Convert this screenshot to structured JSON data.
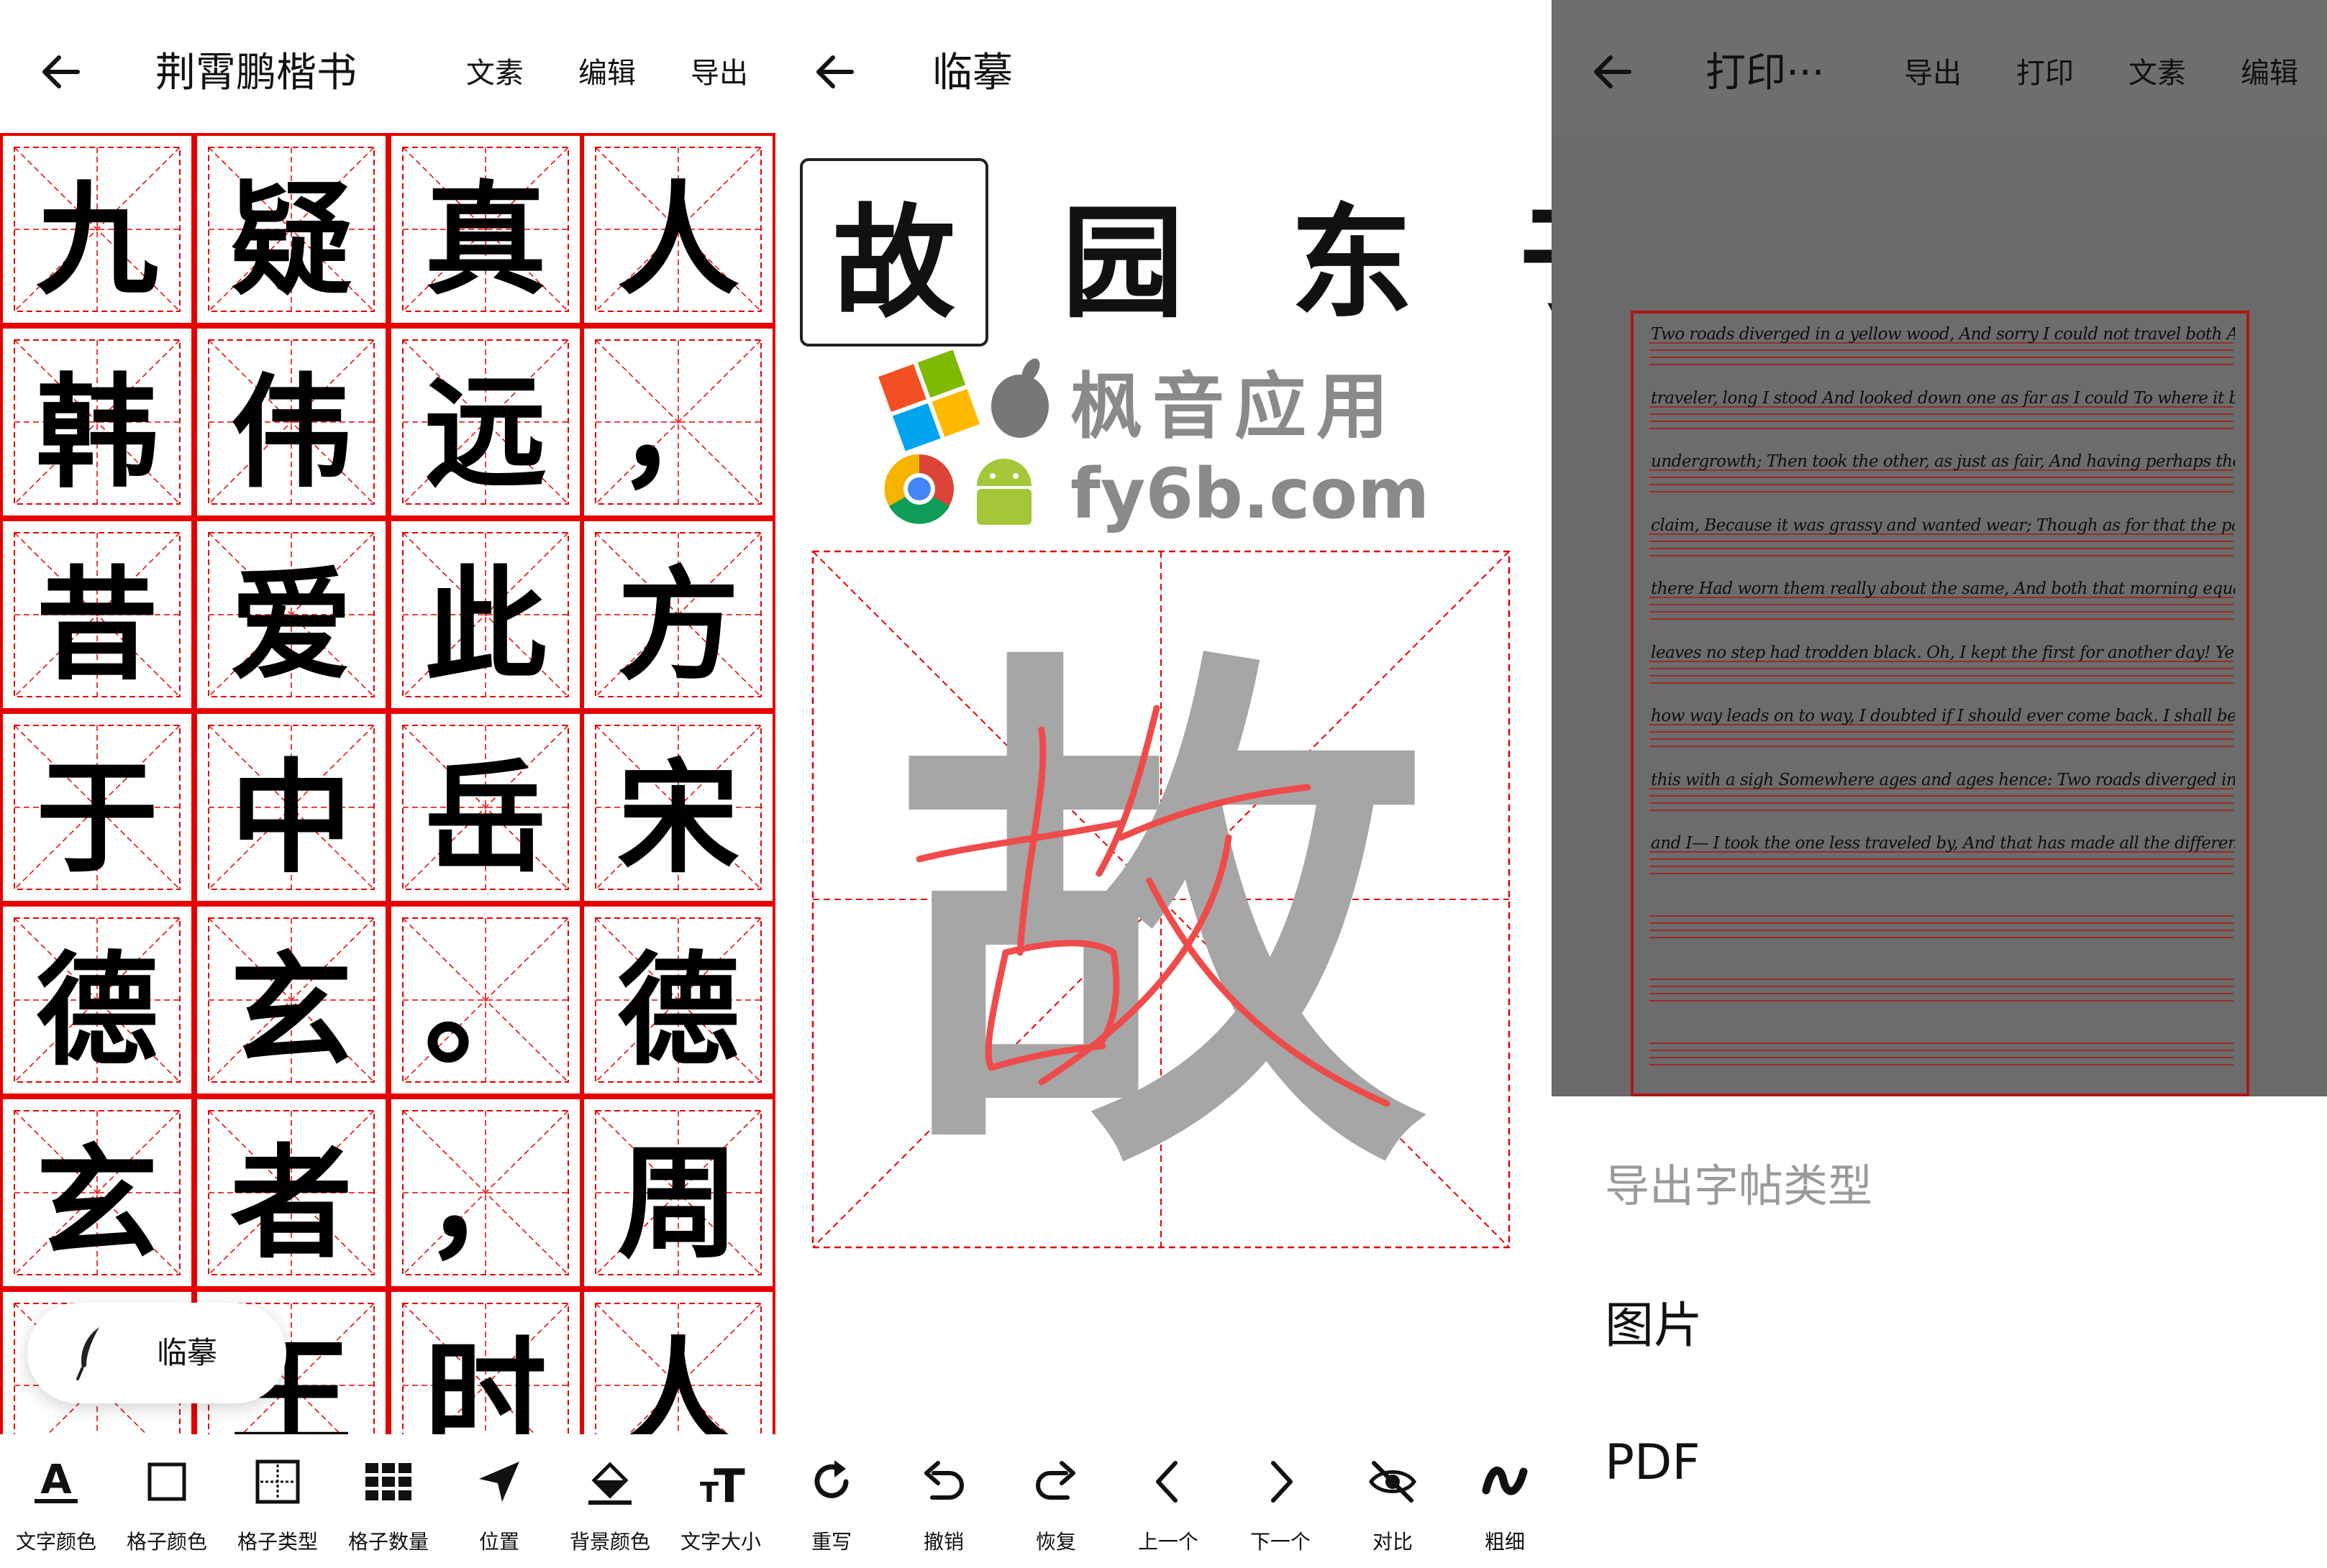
{
  "colors": {
    "grid_red": "#e60000",
    "trace_red": "#ef4b4b",
    "ghost_gray": "#a6a6a6",
    "overlay_gray": "#6a6a6a"
  },
  "editor": {
    "title": "荆霄鹏楷书",
    "actions": [
      "文素",
      "编辑",
      "导出"
    ],
    "grid_rows": [
      [
        "九",
        "疑",
        "真",
        "人"
      ],
      [
        "韩",
        "伟",
        "远",
        "，"
      ],
      [
        "昔",
        "爱",
        "此",
        "方"
      ],
      [
        "于",
        "中",
        "岳",
        "宋"
      ],
      [
        "德",
        "玄",
        "。",
        "德"
      ],
      [
        "玄",
        "者",
        "，",
        "周"
      ],
      [
        "",
        "王",
        "时",
        "人"
      ]
    ],
    "fab_label": "临摹",
    "toolbar": [
      {
        "icon": "text-color-icon",
        "label": "文字颜色"
      },
      {
        "icon": "cell-color-icon",
        "label": "格子颜色"
      },
      {
        "icon": "cell-type-icon",
        "label": "格子类型"
      },
      {
        "icon": "cell-count-icon",
        "label": "格子数量"
      },
      {
        "icon": "position-icon",
        "label": "位置"
      },
      {
        "icon": "bg-color-icon",
        "label": "背景颜色"
      },
      {
        "icon": "text-size-icon",
        "label": "文字大小"
      }
    ]
  },
  "practice": {
    "title": "临摹",
    "chars": [
      "故",
      "园",
      "东",
      "于"
    ],
    "current_char": "故",
    "watermark": {
      "line1": "枫音应用",
      "line2": "fy6b.com"
    },
    "toolbar": [
      {
        "icon": "rewrite-icon",
        "label": "重写"
      },
      {
        "icon": "undo-icon",
        "label": "撤销"
      },
      {
        "icon": "redo-icon",
        "label": "恢复"
      },
      {
        "icon": "prev-icon",
        "label": "上一个"
      },
      {
        "icon": "next-icon",
        "label": "下一个"
      },
      {
        "icon": "compare-icon",
        "label": "对比"
      },
      {
        "icon": "stroke-width-icon",
        "label": "粗细"
      }
    ]
  },
  "print": {
    "title": "打印···",
    "actions": [
      "导出",
      "打印",
      "文素",
      "编辑"
    ],
    "lines": [
      "Two roads diverged in a yellow wood, And sorry I could not travel both And be one",
      "traveler, long I stood And looked down one as far as I could To where it bent in the",
      "undergrowth;  Then took the other, as just as fair, And having perhaps the better",
      "claim, Because it was grassy and wanted wear; Though as for that the passing",
      "there Had worn them really about the same,  And both that morning equally lay In",
      "leaves no step had trodden black. Oh, I kept the first for another day! Yet knowing",
      "how way leads on to way, I doubted if I should ever come back.  I shall be telling",
      "this with a sigh Somewhere ages and ages hence: Two roads diverged in a wood,",
      "and I— I took the one less traveled by, And that has made all the difference."
    ],
    "sheet_title": "导出字帖类型",
    "options": [
      "图片",
      "PDF"
    ]
  }
}
